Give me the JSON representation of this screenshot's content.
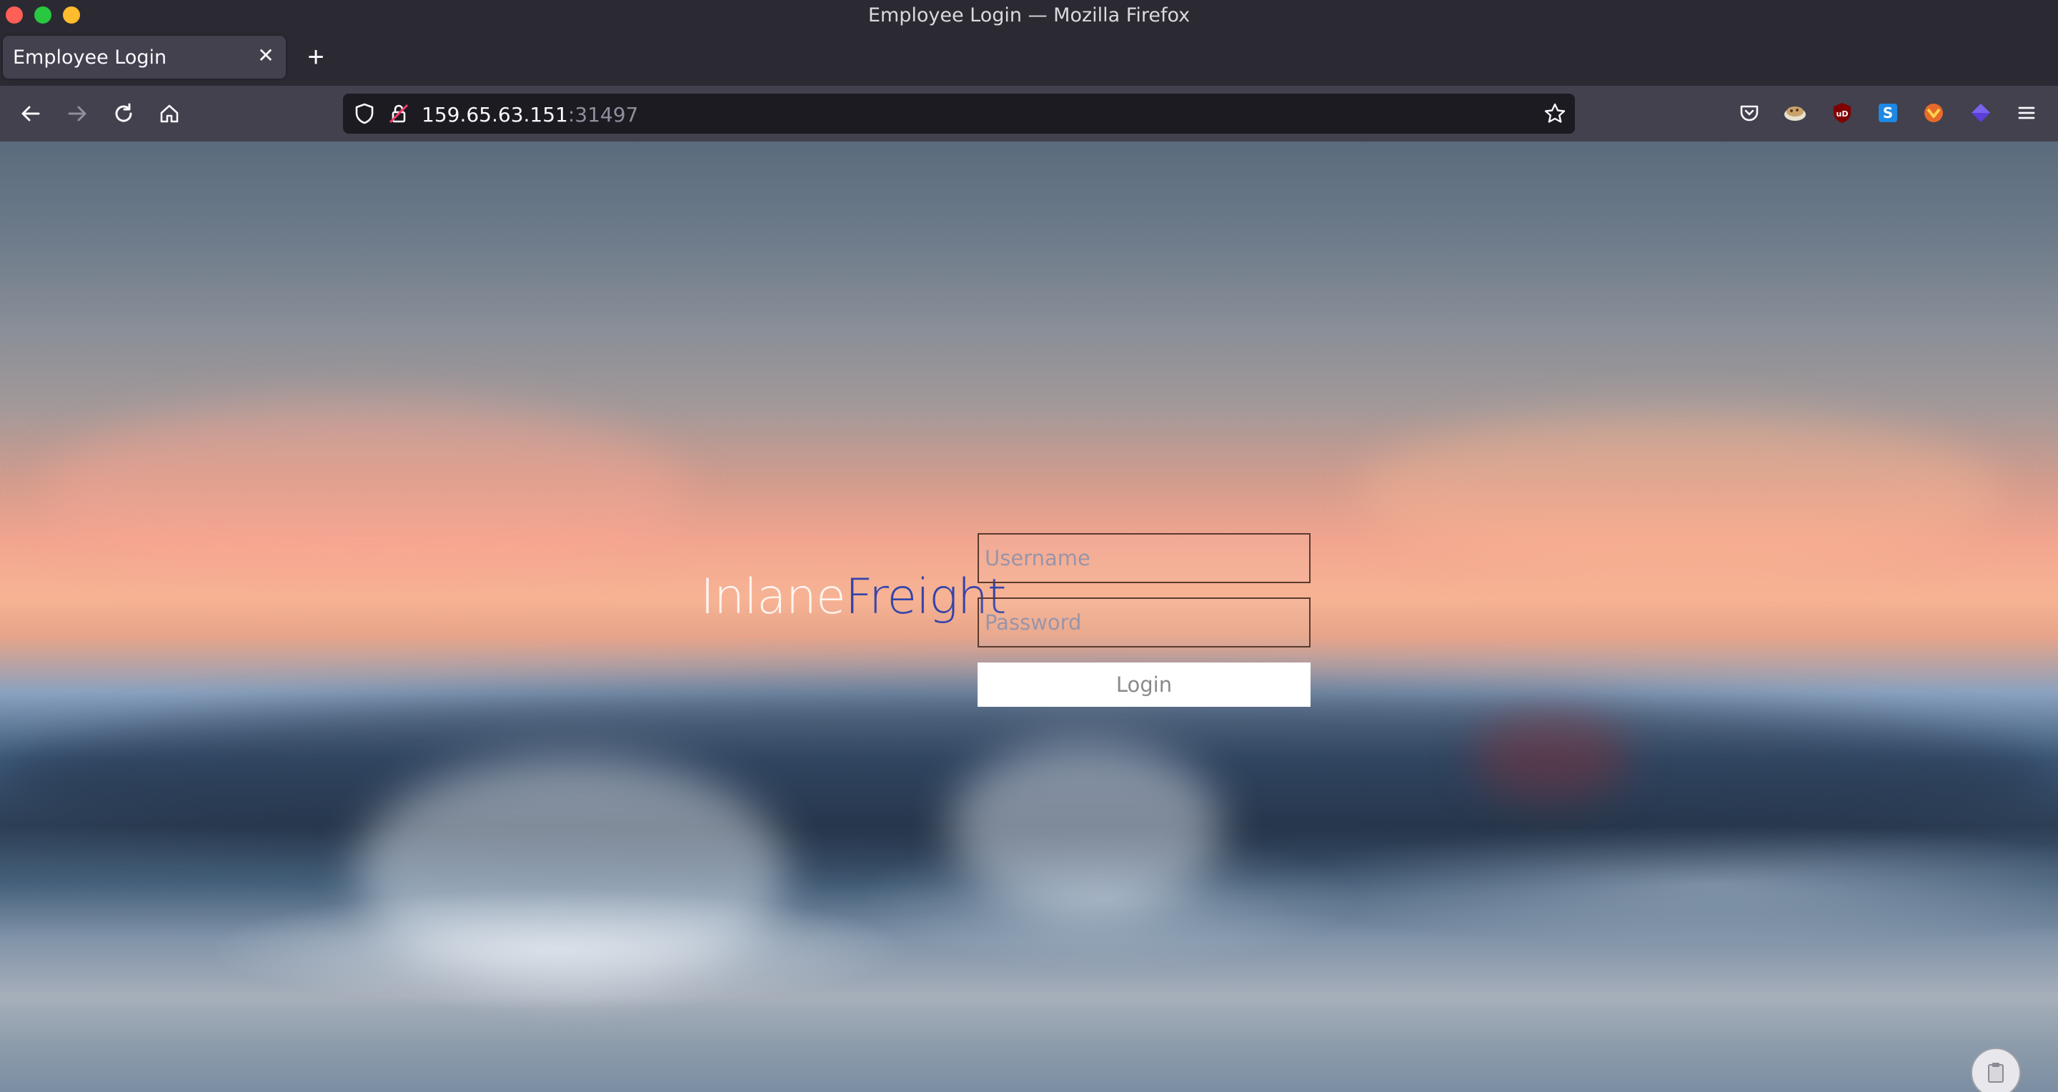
{
  "window": {
    "title": "Employee Login — Mozilla Firefox"
  },
  "tabs": [
    {
      "label": "Employee Login"
    }
  ],
  "url": {
    "host": "159.65.63.151",
    "port": ":31497"
  },
  "login": {
    "brand_part1": "Inlane",
    "brand_part2": "Freight",
    "username_placeholder": "Username",
    "password_placeholder": "Password",
    "button_label": "Login"
  },
  "colors": {
    "brand_accent": "#3344aa",
    "window_bg": "#2b2a33",
    "toolbar_bg": "#42414d",
    "urlbar_bg": "#1c1b22"
  },
  "icons": {
    "nav": [
      "back-arrow-icon",
      "forward-arrow-icon",
      "reload-icon",
      "home-icon"
    ],
    "urlbar": [
      "tracking-shield-icon",
      "insecure-lock-icon",
      "bookmark-star-icon"
    ],
    "extensions": [
      "pocket-icon",
      "cookie-icon",
      "ublock-icon",
      "s-extension-icon",
      "wappalyzer-icon",
      "purple-extension-icon",
      "menu-hamburger-icon"
    ]
  }
}
